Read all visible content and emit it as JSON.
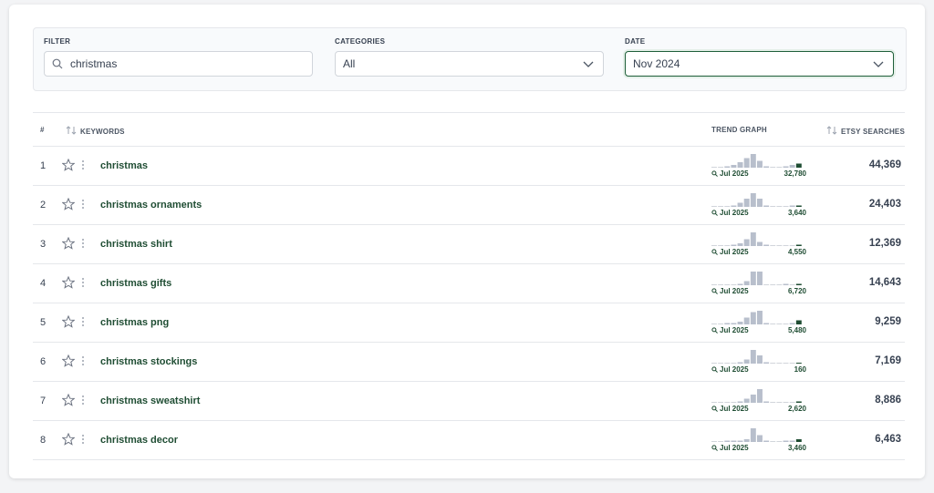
{
  "filters": {
    "filter": {
      "label": "FILTER",
      "value": "christmas"
    },
    "categories": {
      "label": "CATEGORIES",
      "value": "All"
    },
    "date": {
      "label": "DATE",
      "value": "Nov 2024"
    }
  },
  "table": {
    "headers": {
      "num": "#",
      "keywords": "KEYWORDS",
      "trend": "TREND GRAPH",
      "searches": "ETSY SEARCHES"
    },
    "rows": [
      {
        "num": "1",
        "keyword": "christmas",
        "month": "Jul 2025",
        "current": "32,780",
        "searches": "44,369",
        "bars": [
          0,
          0,
          1,
          2,
          4,
          7,
          10,
          5,
          1,
          0,
          0,
          1,
          2,
          3
        ]
      },
      {
        "num": "2",
        "keyword": "christmas ornaments",
        "month": "Jul 2025",
        "current": "3,640",
        "searches": "24,403",
        "bars": [
          0,
          0,
          0,
          1,
          3,
          6,
          10,
          6,
          1,
          0,
          0,
          0,
          1,
          1
        ]
      },
      {
        "num": "3",
        "keyword": "christmas shirt",
        "month": "Jul 2025",
        "current": "4,550",
        "searches": "12,369",
        "bars": [
          0,
          0,
          0,
          1,
          2,
          5,
          10,
          3,
          1,
          0,
          0,
          0,
          0,
          1
        ]
      },
      {
        "num": "4",
        "keyword": "christmas gifts",
        "month": "Jul 2025",
        "current": "6,720",
        "searches": "14,643",
        "bars": [
          0,
          0,
          0,
          0,
          1,
          3,
          10,
          10,
          0,
          0,
          0,
          1,
          0,
          1
        ]
      },
      {
        "num": "5",
        "keyword": "christmas png",
        "month": "Jul 2025",
        "current": "5,480",
        "searches": "9,259",
        "bars": [
          0,
          0,
          1,
          1,
          2,
          5,
          9,
          10,
          1,
          0,
          0,
          0,
          1,
          3
        ]
      },
      {
        "num": "6",
        "keyword": "christmas stockings",
        "month": "Jul 2025",
        "current": "160",
        "searches": "7,169",
        "bars": [
          0,
          0,
          0,
          0,
          1,
          3,
          10,
          6,
          1,
          0,
          0,
          0,
          0,
          0
        ]
      },
      {
        "num": "7",
        "keyword": "christmas sweatshirt",
        "month": "Jul 2025",
        "current": "2,620",
        "searches": "8,886",
        "bars": [
          0,
          0,
          0,
          0,
          1,
          3,
          6,
          10,
          1,
          0,
          0,
          0,
          0,
          1
        ]
      },
      {
        "num": "8",
        "keyword": "christmas decor",
        "month": "Jul 2025",
        "current": "3,460",
        "searches": "6,463",
        "bars": [
          0,
          0,
          1,
          1,
          1,
          2,
          10,
          5,
          1,
          0,
          0,
          1,
          1,
          2
        ]
      }
    ]
  },
  "colors": {
    "accent": "#1f5f3a",
    "bar": "#b8bfcc",
    "bar_last": "#1f4d33"
  }
}
